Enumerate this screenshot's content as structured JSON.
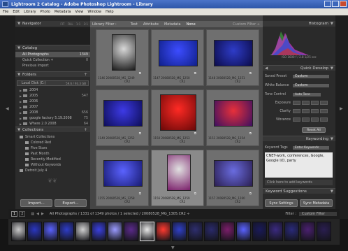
{
  "window": {
    "title": "Lightroom 2 Catalog - Adobe Photoshop Lightroom - Library"
  },
  "menu": [
    "File",
    "Edit",
    "Library",
    "Photo",
    "Metadata",
    "View",
    "Window",
    "Help"
  ],
  "navigator": {
    "title": "Navigator",
    "zoom": [
      "FIT",
      "FILL",
      "1:1",
      "3:1"
    ]
  },
  "catalog": {
    "title": "Catalog",
    "items": [
      {
        "label": "All Photographs",
        "count": "1349"
      },
      {
        "label": "Quick Collection +",
        "count": "0"
      },
      {
        "label": "Previous Import",
        "count": ""
      }
    ]
  },
  "folders": {
    "title": "Folders",
    "disk": {
      "label": "Local Disk (C:)",
      "info": "59.6 / 93.3 GB"
    },
    "items": [
      {
        "label": "2004",
        "count": ""
      },
      {
        "label": "2005",
        "count": "547"
      },
      {
        "label": "2006",
        "count": ""
      },
      {
        "label": "2007",
        "count": ""
      },
      {
        "label": "2008",
        "count": "656"
      },
      {
        "label": "google factory 5.19.2008",
        "count": "75"
      },
      {
        "label": "Where 2.0 2008",
        "count": "64"
      }
    ]
  },
  "collections": {
    "title": "Collections",
    "items": [
      {
        "label": "Smart Collections"
      },
      {
        "label": "Colored Red"
      },
      {
        "label": "Five Stars"
      },
      {
        "label": "Past Month"
      },
      {
        "label": "Recently Modified"
      },
      {
        "label": "Without Keywords"
      },
      {
        "label": "Detroit July 4"
      }
    ]
  },
  "buttons": {
    "import": "Import...",
    "export": "Export...",
    "sync_settings": "Sync Settings",
    "sync_metadata": "Sync Metadata"
  },
  "filterbar": {
    "title": "Library Filter :",
    "tabs": [
      "Text",
      "Attribute",
      "Metadata",
      "None"
    ],
    "custom": "Custom Filter ÷"
  },
  "photos": [
    {
      "num": "1146",
      "file": "20080528_MG_1249",
      "ext": "CR2"
    },
    {
      "num": "1147",
      "file": "20080528_MG_1250",
      "ext": "CR2"
    },
    {
      "num": "1148",
      "file": "20080528_MG_1251",
      "ext": "CR2"
    },
    {
      "num": "1149",
      "file": "20080528_MG_1252",
      "ext": "CR2"
    },
    {
      "num": "1150",
      "file": "20080528_MG_1253",
      "ext": "CR2"
    },
    {
      "num": "1151",
      "file": "20080528_MG_1254",
      "ext": "CR2"
    },
    {
      "num": "1155",
      "file": "20080528_MG_1258",
      "ext": "CR2"
    },
    {
      "num": "1156",
      "file": "20080528_MG_1259",
      "ext": "CR2"
    },
    {
      "num": "1157",
      "file": "20080528_MG_1260",
      "ext": "CR2"
    }
  ],
  "photo_colors": [
    [
      "#d8d8d8",
      "#1b1b1b"
    ],
    [
      "#3c4cff",
      "#10208a"
    ],
    [
      "#2e3cc8",
      "#0c0c4a"
    ],
    [
      "#3d3ae6",
      "#0e0e58"
    ],
    [
      "#ff2a24",
      "#6a0808"
    ],
    [
      "#e8303a",
      "#3c1060"
    ],
    [
      "#5a62ff",
      "#181a70"
    ],
    [
      "#e0e0e0",
      "#7a1e6a"
    ],
    [
      "#6a6ce0",
      "#2a1e50"
    ]
  ],
  "histogram": {
    "title": "Histogram",
    "info": "ISO 1600   f / 2.8   1/25 sec",
    "labels": [
      "1/1000",
      "",
      "f / 2.8",
      ""
    ]
  },
  "quick_develop": {
    "title": "Quick Develop",
    "saved_preset": {
      "label": "Saved Preset",
      "value": "Custom"
    },
    "white_balance": {
      "label": "White Balance",
      "value": "Custom"
    },
    "tone_control": {
      "label": "Tone Control",
      "value": "Auto Tone"
    },
    "sliders": [
      "Exposure",
      "Clarity",
      "Vibrance"
    ],
    "reset": "Reset All"
  },
  "keywording": {
    "title": "Keywording",
    "tags_label": "Keyword Tags",
    "tags_value": "Enter Keywords",
    "keywords": "CNET-work, conferences, Google, Google I/O, party",
    "add_placeholder": "Click here to add keywords",
    "suggestions": "Keyword Suggestions"
  },
  "statusbar": {
    "pages": [
      "1",
      "2"
    ],
    "text": "All Photographs / 1331 of 1349 photos / 1 selected / 20080528_MG_1305.CR2 ÷",
    "filter_label": "Filter :",
    "filter_value": "Custom Filter"
  },
  "filmstrip": {
    "colors": [
      "#c8c8c8",
      "#2a36c0",
      "#5a62ff",
      "#2e3cc8",
      "#d0d0d0",
      "#3a40e0",
      "#9a9aff",
      "#5a2a8a",
      "#e8e8e8",
      "#ff3a30",
      "#3040c8",
      "#2e2e6e",
      "#2a2a6a",
      "#7a1e6a",
      "#5a62ff",
      "#1a1a5a",
      "#3a2a80",
      "#2a2a7a",
      "#4a2070",
      "#2a1e50"
    ],
    "selected_index": 8
  }
}
